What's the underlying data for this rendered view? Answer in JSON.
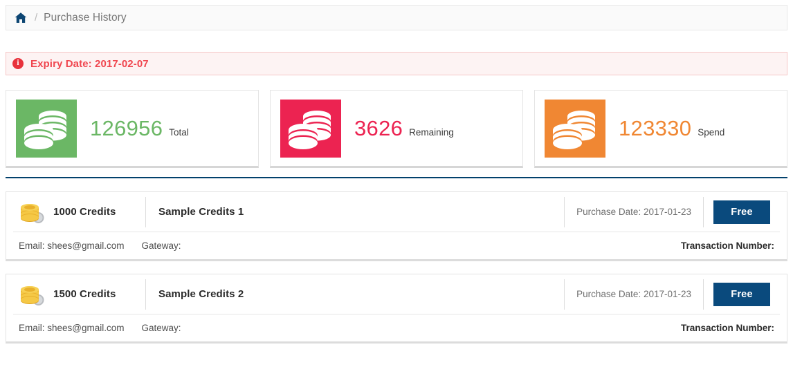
{
  "breadcrumb": {
    "home_icon": "home-icon",
    "separator": "/",
    "current": "Purchase History"
  },
  "alert": {
    "icon": "info-circle-icon",
    "text": "Expiry Date: 2017-02-07",
    "text_color": "#f0464f",
    "background": "#fdf3f3",
    "border_color": "#f5c6c6"
  },
  "stats": [
    {
      "icon": "coins-stack-icon",
      "value": "126956",
      "label": "Total",
      "color": "#6bb765"
    },
    {
      "icon": "coins-stack-icon",
      "value": "3626",
      "label": "Remaining",
      "color": "#ec2351"
    },
    {
      "icon": "coins-stack-icon",
      "value": "123330",
      "label": "Spend",
      "color": "#f08733"
    }
  ],
  "divider_color": "#02416c",
  "purchases": [
    {
      "icon": "gold-coins-icon",
      "credits": "1000 Credits",
      "title": "Sample Credits 1",
      "date": "Purchase Date: 2017-01-23",
      "badge": "Free",
      "badge_color": "#0a4a7d",
      "email": "Email: shees@gmail.com",
      "gateway": "Gateway:",
      "transaction": "Transaction Number:"
    },
    {
      "icon": "gold-coins-icon",
      "credits": "1500 Credits",
      "title": "Sample Credits 2",
      "date": "Purchase Date: 2017-01-23",
      "badge": "Free",
      "badge_color": "#0a4a7d",
      "email": "Email: shees@gmail.com",
      "gateway": "Gateway:",
      "transaction": "Transaction Number:"
    }
  ]
}
